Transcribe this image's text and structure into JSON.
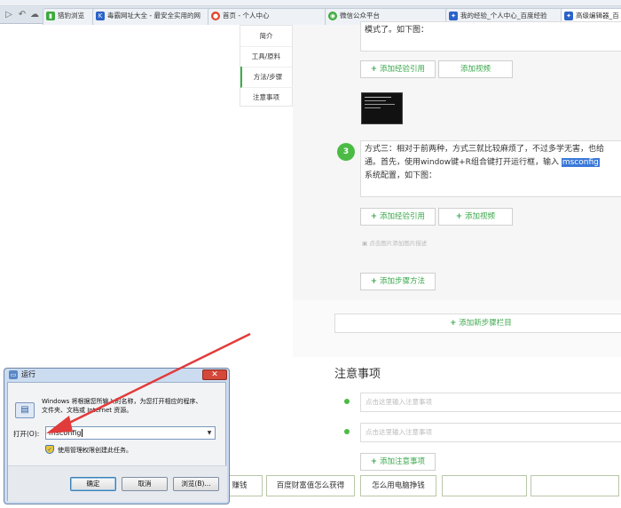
{
  "browser": {
    "tabs": [
      {
        "label": "猎豹浏览",
        "icon_color": "#3caa3c",
        "icon": "leaf-icon"
      },
      {
        "label": "毒霸网址大全 - 最安全实用的网",
        "icon_color": "#2b63c9",
        "icon": "k-logo-icon"
      },
      {
        "label": "首页 - 个人中心",
        "icon_color": "#e0452d",
        "icon": "circle-logo-icon"
      },
      {
        "label": "微信公众平台",
        "icon_color": "#3caa3c",
        "icon": "wechat-icon"
      },
      {
        "label": "我的经验_个人中心_百度经验",
        "icon_color": "#2b63c9",
        "icon": "paw-icon"
      },
      {
        "label": "高级编辑器_百",
        "icon_color": "#2b63c9",
        "icon": "paw-icon"
      }
    ]
  },
  "side_menu": {
    "items": [
      "简介",
      "工具/原料",
      "方法/步骤",
      "注意事项"
    ]
  },
  "editor": {
    "step2_tail": "模式了。如下图：",
    "add_quote": "添加经验引用",
    "add_video": "添加视频",
    "step3_number": "3",
    "step3_text_a": "方式三：相对于前两种，方式三就比较麻烦了，不过多学无害，也给",
    "step3_text_b": "通。首先，使用window键+R组合键打开运行框，输入",
    "step3_highlight": "msconfig",
    "step3_text_c": "系统配置，如下图：",
    "image_hint": "点击图片添加图片描述",
    "add_step_method": "添加步骤方法",
    "add_new_section": "添加新步骤栏目",
    "notes_title": "注意事项",
    "note_placeholder": "点击这里输入注意事项",
    "add_note": "添加注意事项"
  },
  "bottom_links": [
    "赚钱",
    "百度财富值怎么获得",
    "怎么用电脑挣钱"
  ],
  "run_dialog": {
    "title": "运行",
    "description_line1": "Windows 将根据您所输入的名称，为您打开相应的程序、",
    "description_line2": "文件夹、文档或 Internet 资源。",
    "open_label": "打开(O):",
    "open_value": "msconfig",
    "admin_note": "使用管理权限创建此任务。",
    "ok": "确定",
    "cancel": "取消",
    "browse": "浏览(B)..."
  },
  "colors": {
    "accent_green": "#4cbb45",
    "button_text_green": "#3aa84b",
    "selection_blue": "#3a78d8",
    "arrow_red": "#e23b3b",
    "dialog_frame": "#cbdcf1",
    "close_red": "#d4483a"
  }
}
